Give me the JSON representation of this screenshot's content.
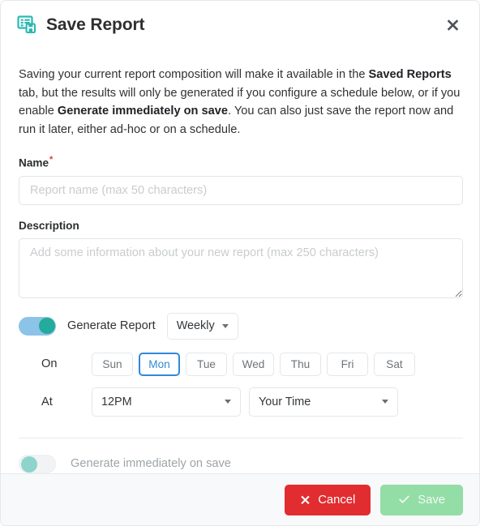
{
  "dialog": {
    "title": "Save Report",
    "title_icon": "report-save-icon",
    "close_icon": "close-icon",
    "accent_teal": "#23ab9b",
    "accent_blue": "#2f89db",
    "danger_red": "#e12d30",
    "success_green": "#93dda7"
  },
  "intro": {
    "part1": "Saving your current report composition will make it available in the ",
    "bold1": "Saved Reports",
    "part2": " tab, but the results will only be generated if you configure a schedule below, or if you enable ",
    "bold2": "Generate immediately on save",
    "part3": ". You can also just save the report now and run it later, either ad-hoc or on a schedule."
  },
  "name_field": {
    "label": "Name",
    "required_marker": "*",
    "placeholder": "Report name (max 50 characters)",
    "value": ""
  },
  "description_field": {
    "label": "Description",
    "placeholder": "Add some information about your new report (max 250 characters)",
    "value": ""
  },
  "schedule": {
    "toggle_state": "on",
    "label": "Generate Report",
    "frequency_selected": "Weekly",
    "frequency_options": [
      "Weekly"
    ],
    "on_label": "On",
    "days": [
      {
        "label": "Sun",
        "selected": false
      },
      {
        "label": "Mon",
        "selected": true
      },
      {
        "label": "Tue",
        "selected": false
      },
      {
        "label": "Wed",
        "selected": false
      },
      {
        "label": "Thu",
        "selected": false
      },
      {
        "label": "Fri",
        "selected": false
      },
      {
        "label": "Sat",
        "selected": false
      }
    ],
    "at_label": "At",
    "time_selected": "12PM",
    "timezone_selected": "Your Time"
  },
  "immediate": {
    "toggle_state": "off",
    "label": "Generate immediately on save"
  },
  "footer": {
    "cancel_label": "Cancel",
    "cancel_icon": "x-icon",
    "save_label": "Save",
    "save_icon": "check-icon"
  }
}
